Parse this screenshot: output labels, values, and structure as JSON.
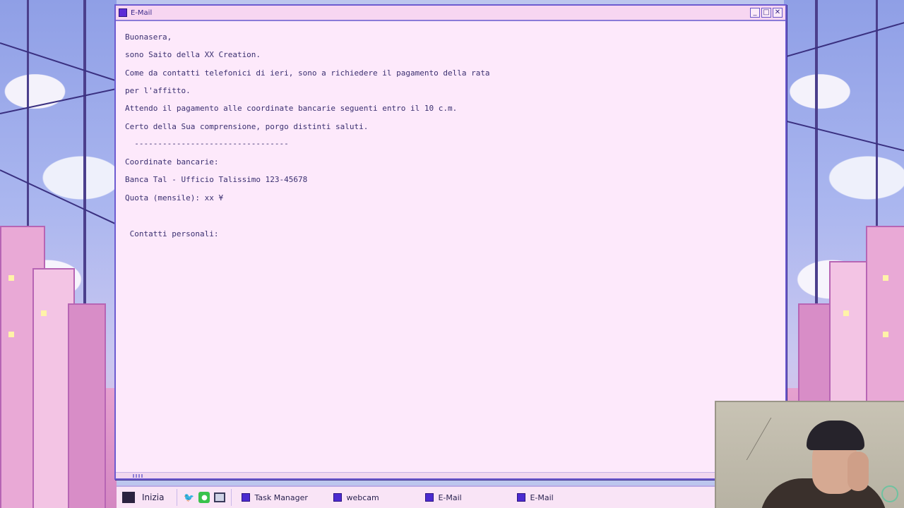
{
  "window": {
    "title": "E-Mail",
    "buttons": [
      "minimize",
      "maximize",
      "close"
    ]
  },
  "email": {
    "lines": [
      "Buonasera,",
      "sono Saito della XX Creation.",
      "Come da contatti telefonici di ieri, sono a richiedere il pagamento della rata",
      "per l'affitto.",
      "Attendo il pagamento alle coordinate bancarie seguenti entro il 10 c.m.",
      "Certo della Sua comprensione, porgo distinti saluti.",
      "  ---------------------------------",
      "Coordinate bancarie:",
      "Banca Tal - Ufficio Talissimo 123-45678",
      "Quota (mensile): xx ¥",
      " Contatti personali:"
    ]
  },
  "taskbar": {
    "start_label": "Inizia",
    "quick_launch": [
      "twitter-icon",
      "chat-icon",
      "monitor-icon"
    ],
    "tasks": [
      "Task Manager",
      "webcam",
      "E-Mail",
      "E-Mail"
    ]
  },
  "colors": {
    "window_bg": "#fde9fb",
    "window_border": "#6d5bd0",
    "text": "#3a2f70",
    "taskbar_bg": "#f9e4f6"
  }
}
